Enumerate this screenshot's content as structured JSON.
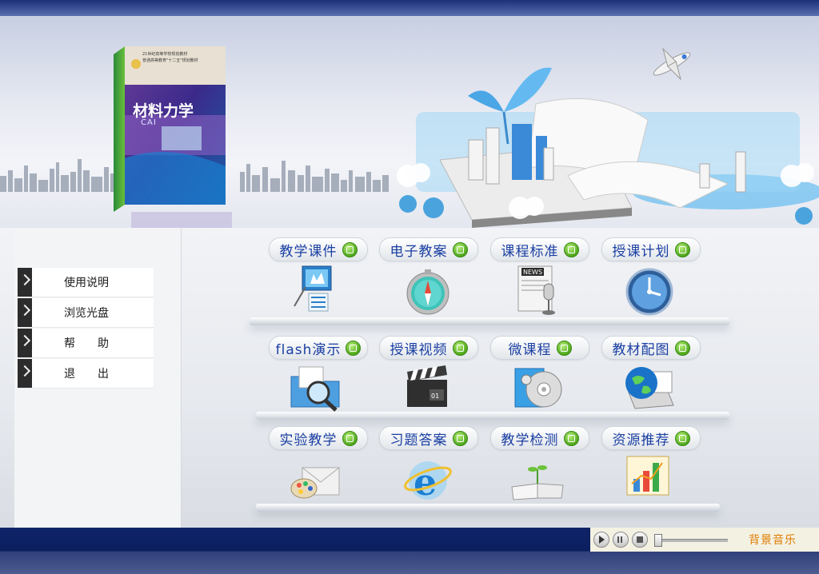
{
  "book": {
    "title": "材料力学",
    "series_line1": "21世纪高等学校规划教材",
    "series_line2": "普通高等教育\"十二五\"规划教材",
    "cover_logo_text": "CAI"
  },
  "sidebar": {
    "items": [
      {
        "label": "使用说明"
      },
      {
        "label": "浏览光盘"
      },
      {
        "label": "帮　　助"
      },
      {
        "label": "退　　出"
      }
    ]
  },
  "modules": {
    "row1": [
      {
        "label": "教学课件",
        "icon": "presentation-board-icon"
      },
      {
        "label": "电子教案",
        "icon": "compass-icon"
      },
      {
        "label": "课程标准",
        "icon": "news-microphone-icon"
      },
      {
        "label": "授课计划",
        "icon": "clock-icon"
      }
    ],
    "row2": [
      {
        "label": "flash演示",
        "icon": "folder-search-icon"
      },
      {
        "label": "授课视频",
        "icon": "clapperboard-icon"
      },
      {
        "label": "微课程",
        "icon": "media-disc-icon"
      },
      {
        "label": "教材配图",
        "icon": "globe-laptop-icon"
      }
    ],
    "row3": [
      {
        "label": "实验教学",
        "icon": "mail-palette-icon"
      },
      {
        "label": "习题答案",
        "icon": "internet-explorer-icon"
      },
      {
        "label": "教学检测",
        "icon": "open-book-sprout-icon"
      },
      {
        "label": "资源推荐",
        "icon": "bar-chart-icon"
      }
    ]
  },
  "player": {
    "label": "背景音乐",
    "volume": 0.0
  },
  "colors": {
    "nav_text": "#1a3fa3",
    "accent_green": "#4ea71c",
    "bottom_bar": "#0f2468",
    "music_label": "#e07b00"
  }
}
